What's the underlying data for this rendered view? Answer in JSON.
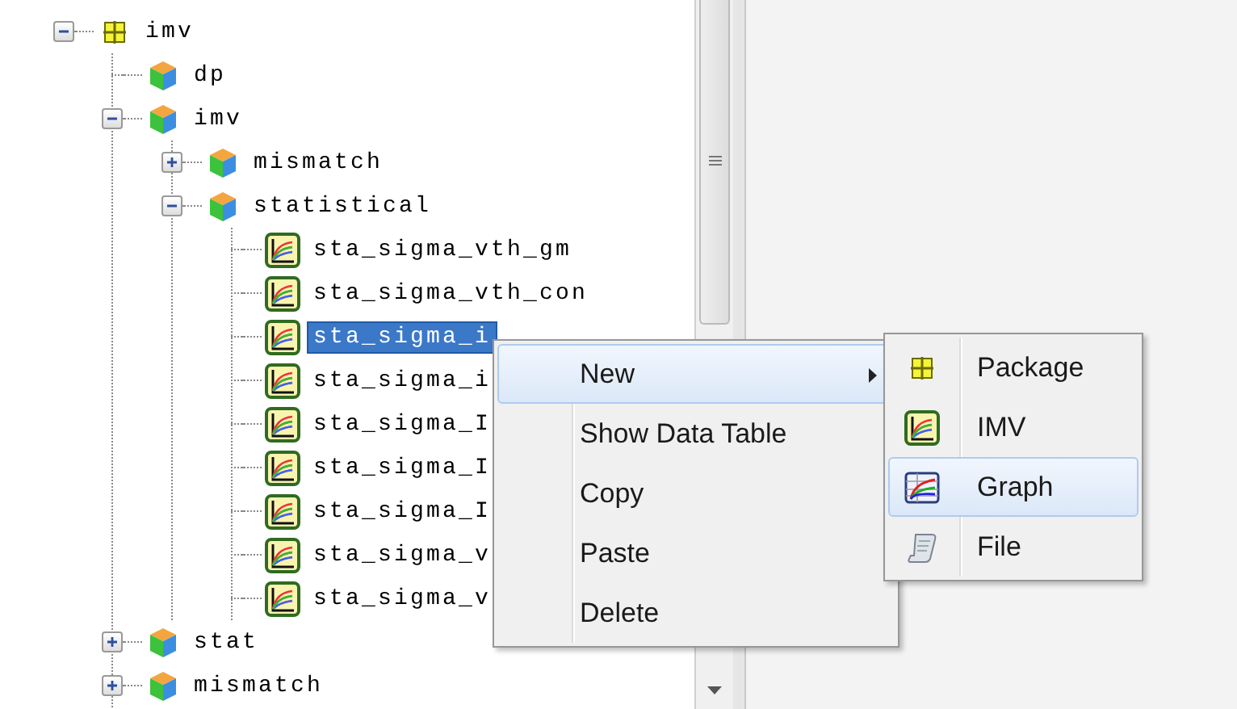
{
  "tree": [
    {
      "label": "imv",
      "kind": "package",
      "expanded": true,
      "selected": false,
      "children": [
        {
          "label": "dp",
          "kind": "folder",
          "selected": false
        },
        {
          "label": "imv",
          "kind": "folder",
          "expanded": true,
          "selected": false,
          "children": [
            {
              "label": "mismatch",
              "kind": "folder",
              "expanded": false,
              "selected": false
            },
            {
              "label": "statistical",
              "kind": "folder",
              "expanded": true,
              "selected": false,
              "children": [
                {
                  "label": "sta_sigma_vth_gm",
                  "kind": "imv",
                  "selected": false
                },
                {
                  "label": "sta_sigma_vth_con",
                  "kind": "imv",
                  "selected": false
                },
                {
                  "label": "sta_sigma_i",
                  "kind": "imv",
                  "selected": true
                },
                {
                  "label": "sta_sigma_i",
                  "kind": "imv",
                  "selected": false
                },
                {
                  "label": "sta_sigma_I",
                  "kind": "imv",
                  "selected": false
                },
                {
                  "label": "sta_sigma_I",
                  "kind": "imv",
                  "selected": false
                },
                {
                  "label": "sta_sigma_I",
                  "kind": "imv",
                  "selected": false
                },
                {
                  "label": "sta_sigma_v",
                  "kind": "imv",
                  "selected": false
                },
                {
                  "label": "sta_sigma_v",
                  "kind": "imv",
                  "selected": false
                }
              ]
            }
          ]
        },
        {
          "label": "stat",
          "kind": "folder",
          "expanded": false,
          "selected": false
        },
        {
          "label": "mismatch",
          "kind": "folder",
          "expanded": false,
          "selected": false
        }
      ]
    }
  ],
  "context_menu": {
    "items": [
      {
        "label": "New",
        "selected": true,
        "submenu": true
      },
      {
        "label": "Show Data Table",
        "selected": false,
        "submenu": false
      },
      {
        "label": "Copy",
        "selected": false,
        "submenu": false
      },
      {
        "label": "Paste",
        "selected": false,
        "submenu": false
      },
      {
        "label": "Delete",
        "selected": false,
        "submenu": false
      }
    ]
  },
  "submenu": {
    "items": [
      {
        "label": "Package",
        "kind": "package",
        "selected": false
      },
      {
        "label": "IMV",
        "kind": "imv",
        "selected": false
      },
      {
        "label": "Graph",
        "kind": "graph",
        "selected": true
      },
      {
        "label": "File",
        "kind": "file",
        "selected": false
      }
    ]
  }
}
